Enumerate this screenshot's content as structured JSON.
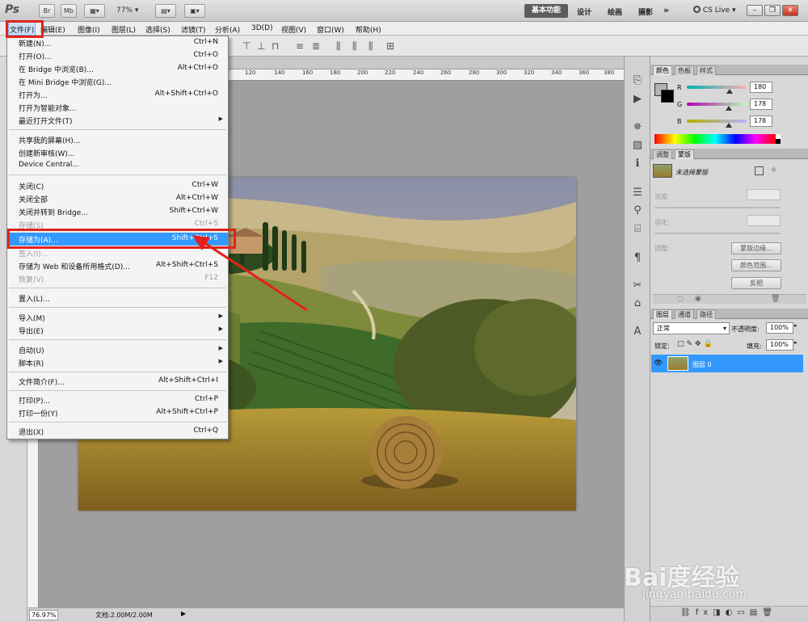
{
  "appbar": {
    "logo": "Ps",
    "btn_br": "Br",
    "btn_mb": "Mb",
    "zoom": "77%",
    "workspaces": [
      "基本功能",
      "设计",
      "绘画",
      "摄影"
    ],
    "more": "»",
    "cs_live": "CS Live"
  },
  "menubar": {
    "items": [
      "文件(F)",
      "编辑(E)",
      "图像(I)",
      "图层(L)",
      "选择(S)",
      "滤镜(T)",
      "分析(A)",
      "3D(D)",
      "视图(V)",
      "窗口(W)",
      "帮助(H)"
    ]
  },
  "ruler": {
    "top": [
      "120",
      "140",
      "160",
      "180",
      "200",
      "220",
      "240",
      "260",
      "280",
      "300",
      "320",
      "340",
      "360",
      "380"
    ]
  },
  "file_menu": {
    "items": [
      {
        "label": "新建(N)...",
        "shortcut": "Ctrl+N"
      },
      {
        "label": "打开(O)...",
        "shortcut": "Ctrl+O"
      },
      {
        "label": "在 Bridge 中浏览(B)...",
        "shortcut": "Alt+Ctrl+O"
      },
      {
        "label": "在 Mini Bridge 中浏览(G)...",
        "shortcut": ""
      },
      {
        "label": "打开为...",
        "shortcut": "Alt+Shift+Ctrl+O"
      },
      {
        "label": "打开为智能对象...",
        "shortcut": ""
      },
      {
        "label": "最近打开文件(T)",
        "shortcut": ""
      },
      {
        "label": "共享我的屏幕(H)...",
        "shortcut": ""
      },
      {
        "label": "创建新审核(W)...",
        "shortcut": ""
      },
      {
        "label": "Device Central...",
        "shortcut": ""
      },
      {
        "label": "关闭(C)",
        "shortcut": "Ctrl+W"
      },
      {
        "label": "关闭全部",
        "shortcut": "Alt+Ctrl+W"
      },
      {
        "label": "关闭并转到 Bridge...",
        "shortcut": "Shift+Ctrl+W"
      },
      {
        "label": "存储(S)",
        "shortcut": "Ctrl+S"
      },
      {
        "label": "存储为(A)...",
        "shortcut": "Shift+Ctrl+S"
      },
      {
        "label": "签入(I)...",
        "shortcut": ""
      },
      {
        "label": "存储为 Web 和设备所用格式(D)...",
        "shortcut": "Alt+Shift+Ctrl+S"
      },
      {
        "label": "恢复(V)",
        "shortcut": "F12"
      },
      {
        "label": "置入(L)...",
        "shortcut": ""
      },
      {
        "label": "导入(M)",
        "shortcut": ""
      },
      {
        "label": "导出(E)",
        "shortcut": ""
      },
      {
        "label": "自动(U)",
        "shortcut": ""
      },
      {
        "label": "脚本(R)",
        "shortcut": ""
      },
      {
        "label": "文件简介(F)...",
        "shortcut": "Alt+Shift+Ctrl+I"
      },
      {
        "label": "打印(P)...",
        "shortcut": "Ctrl+P"
      },
      {
        "label": "打印一份(Y)",
        "shortcut": "Alt+Shift+Ctrl+P"
      },
      {
        "label": "退出(X)",
        "shortcut": "Ctrl+Q"
      }
    ]
  },
  "color_panel": {
    "tabs": [
      "颜色",
      "色板",
      "样式"
    ],
    "r_label": "R",
    "g_label": "G",
    "b_label": "B",
    "r": "180",
    "g": "178",
    "b": "178"
  },
  "adjust_panel": {
    "tabs": [
      "调整",
      "蒙版"
    ],
    "title": "未选择蒙版",
    "density": "浓度:",
    "feather": "羽化:",
    "refine": "调整:",
    "btn_edge": "蒙版边缘...",
    "btn_range": "颜色范围...",
    "btn_invert": "反相"
  },
  "layers_panel": {
    "tabs": [
      "图层",
      "通道",
      "路径"
    ],
    "blend": "正常",
    "opacity_label": "不透明度:",
    "opacity": "100%",
    "lock_label": "锁定:",
    "fill_label": "填充:",
    "fill": "100%",
    "layer_name": "图层 0"
  },
  "status": {
    "zoom": "76.97%",
    "doc": "文档:2.00M/2.00M"
  },
  "watermark": {
    "brand": "Bai度经验",
    "url": "jingyan.baidu.com"
  }
}
